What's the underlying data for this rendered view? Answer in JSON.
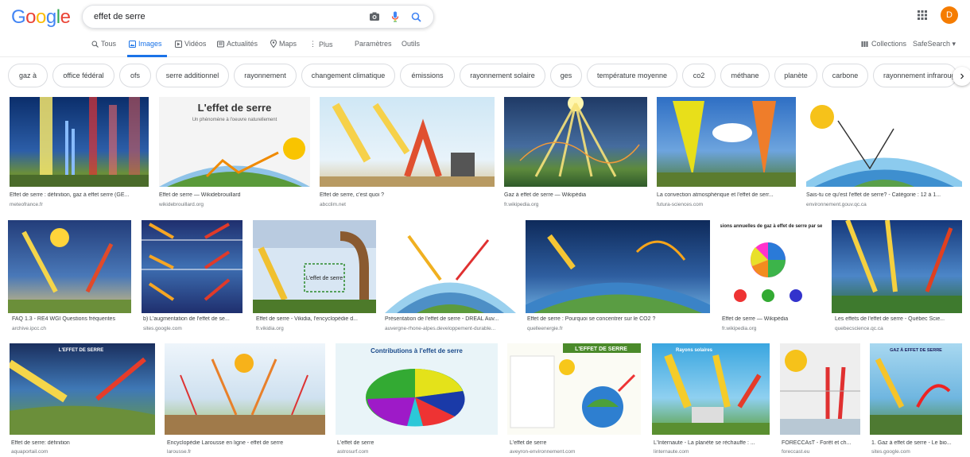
{
  "logo": [
    "G",
    "o",
    "o",
    "g",
    "l",
    "e"
  ],
  "logo_colors": [
    "#4285f4",
    "#ea4335",
    "#fbbc05",
    "#4285f4",
    "#34a853",
    "#ea4335"
  ],
  "search": {
    "query": "effet de serre"
  },
  "account": {
    "initial": "D"
  },
  "tabs": [
    {
      "label": "Tous",
      "icon": "search-icon"
    },
    {
      "label": "Images",
      "icon": "image-icon",
      "active": true
    },
    {
      "label": "Vidéos",
      "icon": "play-icon"
    },
    {
      "label": "Actualités",
      "icon": "news-icon"
    },
    {
      "label": "Maps",
      "icon": "pin-icon"
    },
    {
      "label": "Plus",
      "icon": "more-icon"
    }
  ],
  "tab_settings": "Paramètres",
  "tab_tools": "Outils",
  "collections": "Collections",
  "safesearch": "SafeSearch ▾",
  "chips": [
    "gaz à",
    "office fédéral",
    "ofs",
    "serre additionnel",
    "rayonnement",
    "changement climatique",
    "émissions",
    "rayonnement solaire",
    "ges",
    "température moyenne",
    "co2",
    "méthane",
    "planète",
    "carbone",
    "rayonnement infrarouge"
  ],
  "results": [
    {
      "caption": "Effet de serre : définition, gaz à effet serre (GE...",
      "source": "meteofrance.fr"
    },
    {
      "caption": "Effet de serre — Wikidebrouillard",
      "source": "wikidebrouillard.org",
      "thumb_title": "L'effet de serre",
      "thumb_sub": "Un phénomène à l'oeuvre naturellement"
    },
    {
      "caption": "Effet de serre, c'est quoi ?",
      "source": "abcclim.net"
    },
    {
      "caption": "Gaz à effet de serre — Wikipédia",
      "source": "fr.wikipedia.org"
    },
    {
      "caption": "La convection atmosphérique et l'effet de serr...",
      "source": "futura-sciences.com"
    },
    {
      "caption": "Sais-tu ce qu'est l'effet de serre? - Catégorie : 12 à 1...",
      "source": "environnement.gouv.qc.ca"
    },
    {
      "caption": "FAQ 1.3 - RE4 WGI Questions fréquentes",
      "source": "archive.ipcc.ch"
    },
    {
      "caption": "b) L'augmentation de l'effet de se...",
      "source": "sites.google.com"
    },
    {
      "caption": "Effet de serre - Vikidia, l'encyclopédie d...",
      "source": "fr.vikidia.org",
      "thumb_title": "L'effet de serre"
    },
    {
      "caption": "Présentation de l'effet de serre - DREAL Auv...",
      "source": "auvergne-rhone-alpes.developpement-durable..."
    },
    {
      "caption": "Effet de serre : Pourquoi se concentrer sur le CO2 ?",
      "source": "quelleenergie.fr"
    },
    {
      "caption": "Effet de serre — Wikipédia",
      "source": "fr.wikipedia.org",
      "thumb_title": "Émissions annuelles de gaz à effet de serre par secteur"
    },
    {
      "caption": "Les effets de l'effet de serre - Québec Scie...",
      "source": "quebecscience.qc.ca"
    },
    {
      "caption": "Effet de serre: définition",
      "source": "aquaportail.com",
      "thumb_title": "L'EFFET DE SERRE"
    },
    {
      "caption": "Encyclopédie Larousse en ligne - effet de serre",
      "source": "larousse.fr"
    },
    {
      "caption": "L'effet de serre",
      "source": "astrosurf.com",
      "thumb_title": "Contributions à l'effet de serre"
    },
    {
      "caption": "L'effet de serre",
      "source": "aveyron-environnement.com",
      "thumb_title": "L'EFFET DE SERRE"
    },
    {
      "caption": "L'Internaute - La planète se réchauffe : ...",
      "source": "linternaute.com",
      "thumb_title": "Rayons solaires"
    },
    {
      "caption": "FORECCAsT - Forêt et ch...",
      "source": "foreccast.eu"
    },
    {
      "caption": "1. Gaz à effet de serre - Le bio...",
      "source": "sites.google.com",
      "thumb_title": "GAZ À EFFET DE SERRE"
    }
  ]
}
